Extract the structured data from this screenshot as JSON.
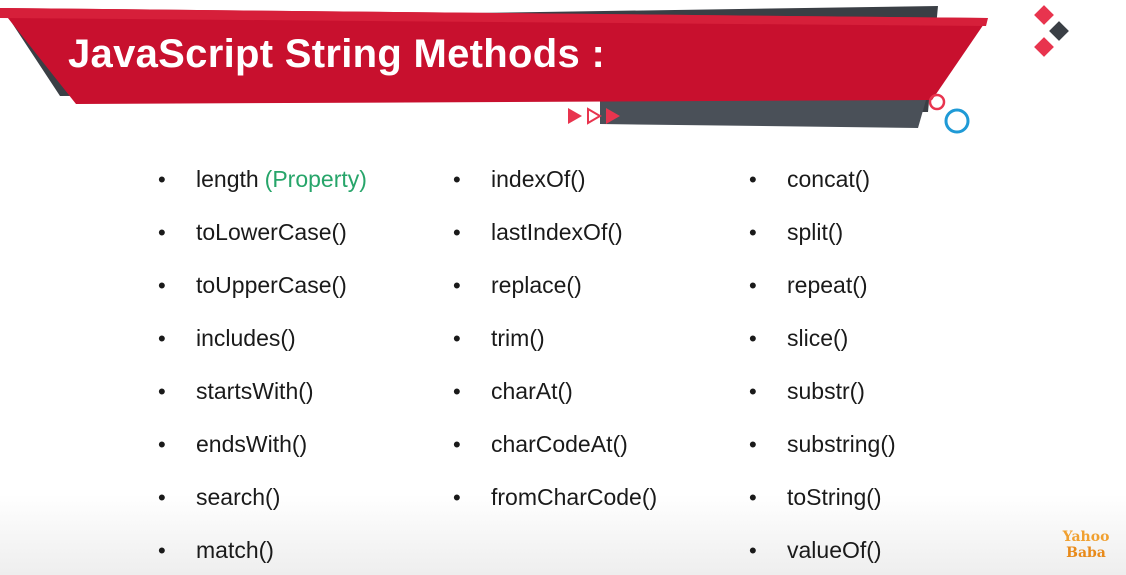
{
  "slide": {
    "title": "JavaScript String Methods :"
  },
  "theme": {
    "banner_red": "#c8102e",
    "banner_dark": "#3a3f45",
    "accent_green": "#27a56a",
    "circle_red": "#e8344e",
    "circle_blue": "#1f9ad6"
  },
  "icons": [
    "diamond-logo-icon",
    "play-arrows-icon",
    "circles-decoration-icon"
  ],
  "columns": [
    {
      "items": [
        {
          "label": "length",
          "note": "(Property)"
        },
        {
          "label": "toLowerCase()"
        },
        {
          "label": "toUpperCase()"
        },
        {
          "label": "includes()"
        },
        {
          "label": "startsWith()"
        },
        {
          "label": "endsWith()"
        },
        {
          "label": "search()"
        },
        {
          "label": "match()"
        }
      ]
    },
    {
      "items": [
        {
          "label": "indexOf()"
        },
        {
          "label": "lastIndexOf()"
        },
        {
          "label": "replace()"
        },
        {
          "label": "trim()"
        },
        {
          "label": "charAt()"
        },
        {
          "label": "charCodeAt()"
        },
        {
          "label": "fromCharCode()"
        }
      ]
    },
    {
      "items": [
        {
          "label": "concat()"
        },
        {
          "label": "split()"
        },
        {
          "label": "repeat()"
        },
        {
          "label": "slice()"
        },
        {
          "label": "substr()"
        },
        {
          "label": "substring()"
        },
        {
          "label": "toString()"
        },
        {
          "label": "valueOf()"
        }
      ]
    }
  ],
  "watermark": {
    "line1": "Yahoo",
    "line2": "Baba"
  }
}
